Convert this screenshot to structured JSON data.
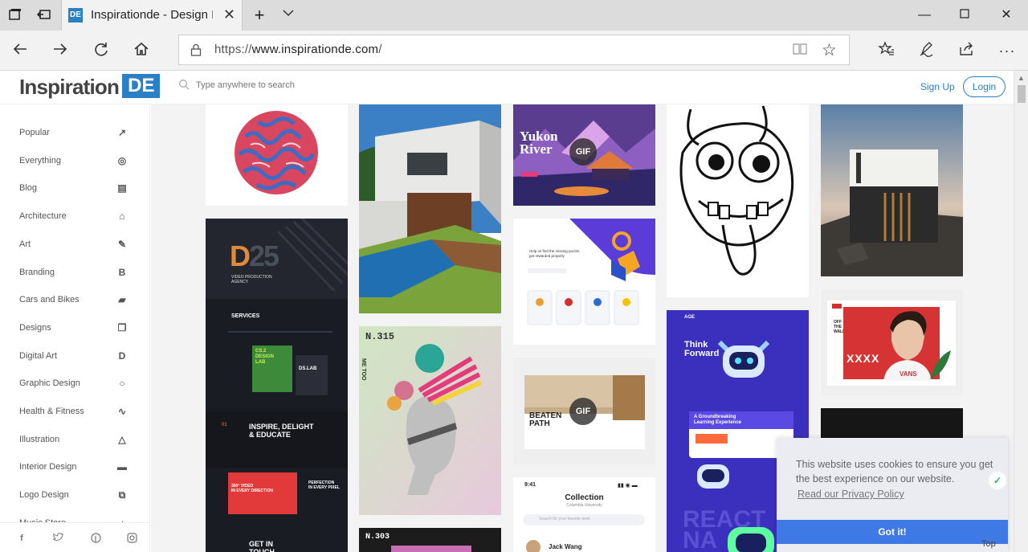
{
  "browser": {
    "tab_title": "Inspirationde - Design I",
    "tab_favicon_text": "DE",
    "url_prefix": "https://",
    "url_host": "www.inspirationde.com",
    "url_suffix": "/",
    "icons": {
      "tab_actions": "tab-manager-icon",
      "set_aside": "set-aside-tabs-icon",
      "new_tab": "plus-icon",
      "tab_list": "chevron-down-icon",
      "back": "back-arrow-icon",
      "forward": "forward-arrow-icon",
      "refresh": "refresh-icon",
      "home": "home-icon",
      "favorites": "favorites-icon",
      "notes": "pen-icon",
      "share": "share-icon",
      "more": "more-icon"
    }
  },
  "header": {
    "logo_text": "Inspiration",
    "logo_box": "DE",
    "search_placeholder": "Type anywhere to search",
    "signup_label": "Sign Up",
    "login_label": "Login"
  },
  "sidebar": {
    "items": [
      {
        "label": "Popular",
        "icon": "trending-icon",
        "glyph": "↗"
      },
      {
        "label": "Everything",
        "icon": "compass-icon",
        "glyph": "◎"
      },
      {
        "label": "Blog",
        "icon": "layout-icon",
        "glyph": "▤"
      },
      {
        "label": "Architecture",
        "icon": "building-icon",
        "glyph": "⌂"
      },
      {
        "label": "Art",
        "icon": "brush-icon",
        "glyph": "✎"
      },
      {
        "label": "Branding",
        "icon": "b-letter-icon",
        "glyph": "B"
      },
      {
        "label": "Cars and Bikes",
        "icon": "car-icon",
        "glyph": "▰"
      },
      {
        "label": "Designs",
        "icon": "layers-icon",
        "glyph": "❐"
      },
      {
        "label": "Digital Art",
        "icon": "d-letter-icon",
        "glyph": "D"
      },
      {
        "label": "Graphic Design",
        "icon": "circle-icon",
        "glyph": "○"
      },
      {
        "label": "Health & Fitness",
        "icon": "pulse-icon",
        "glyph": "∿"
      },
      {
        "label": "Illustration",
        "icon": "triangle-icon",
        "glyph": "△"
      },
      {
        "label": "Interior Design",
        "icon": "sofa-icon",
        "glyph": "▬"
      },
      {
        "label": "Logo Design",
        "icon": "screens-icon",
        "glyph": "⧉"
      },
      {
        "label": "Music Store",
        "icon": "music-icon",
        "glyph": "♪"
      }
    ],
    "footer_icons": [
      "facebook-icon",
      "twitter-icon",
      "pinterest-icon",
      "instagram-icon"
    ]
  },
  "cards": {
    "yukon": {
      "title": "Yukon\nRiver",
      "badge": "GIF"
    },
    "d25": {
      "big": "D25",
      "sub": "VIDEO PRODUCTION\nAGENCY",
      "services": "SERVICES",
      "lab": "CS.2\nDESIGN\nLAB",
      "dslab": "DS.LAB",
      "num": "01",
      "inspire": "INSPIRE, DELIGHT\n& EDUCATE",
      "video": "360° VIDEO\nIN EVERY DIRECTION",
      "perfection": "PERFECTION\nIN EVERY PIXEL",
      "touch": "GET IN\nTOUCH"
    },
    "n315": {
      "title": "N.315",
      "side": "ME TOO"
    },
    "n303": {
      "title": "N.303"
    },
    "puzzle": {
      "text": "Help us find the missing puzzle,\nget rewarded properly"
    },
    "beaten": {
      "title": "BEATEN\nPATH",
      "badge": "GIF"
    },
    "collection": {
      "time": "9:41",
      "title": "Collection",
      "sub": "Columbia University",
      "search": "Search for your favorite work",
      "person": "Jack Wang"
    },
    "think": {
      "title": "Think\nForward",
      "age": "AGE",
      "ground": "A Groundbreaking\nLearning Experience",
      "react": "REACT\nNA"
    },
    "vans": {
      "left": "OFF\nTHE\nWALL",
      "brand": "VANS",
      "xs": "XXXX"
    }
  },
  "cookie": {
    "message": "This website uses cookies to ensure you get the best experience on our website.",
    "link": "Read our Privacy Policy",
    "button": "Got it!",
    "check_icon": "check-icon"
  },
  "scroll_top_label": "Top",
  "colors": {
    "brand": "#2b80c5",
    "cookie_button": "#3f79e6",
    "content_bg": "#f3f3f3"
  }
}
